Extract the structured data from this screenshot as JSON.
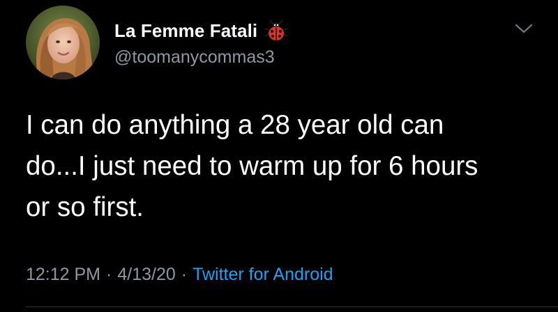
{
  "author": {
    "display_name": "La Femme Fatali",
    "handle": "@toomanycommas3",
    "name_emoji": "ladybug-icon"
  },
  "tweet": {
    "text_lines": [
      "I can do anything a 28 year old can",
      "do...I just need to warm up for 6 hours",
      "or so first."
    ],
    "time": "12:12 PM",
    "date": "4/13/20",
    "separator": "·",
    "source": "Twitter for Android"
  },
  "colors": {
    "background": "#000000",
    "primary_text": "#ffffff",
    "secondary_text": "#8d98a3",
    "link": "#1da1f2"
  }
}
